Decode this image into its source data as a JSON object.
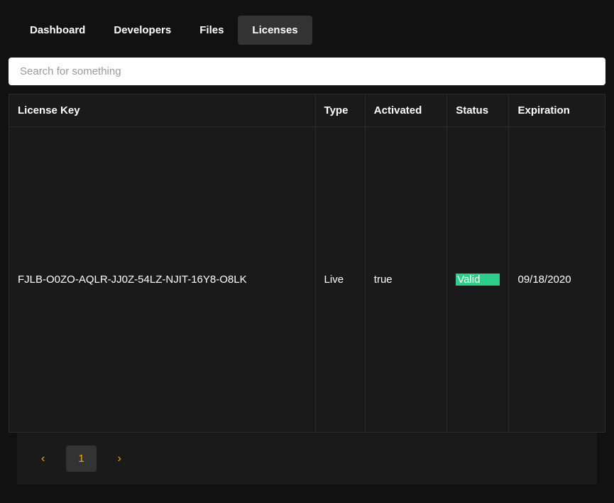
{
  "nav": {
    "items": [
      {
        "label": "Dashboard",
        "active": false
      },
      {
        "label": "Developers",
        "active": false
      },
      {
        "label": "Files",
        "active": false
      },
      {
        "label": "Licenses",
        "active": true
      }
    ]
  },
  "search": {
    "placeholder": "Search for something"
  },
  "table": {
    "headers": {
      "key": "License Key",
      "type": "Type",
      "activated": "Activated",
      "status": "Status",
      "expiration": "Expiration"
    },
    "rows": [
      {
        "key": "FJLB-O0ZO-AQLR-JJ0Z-54LZ-NJIT-16Y8-O8LK",
        "type": "Live",
        "activated": "true",
        "status": "Valid",
        "expiration": "09/18/2020"
      }
    ]
  },
  "pagination": {
    "prev": "‹",
    "current": "1",
    "next": "›"
  }
}
